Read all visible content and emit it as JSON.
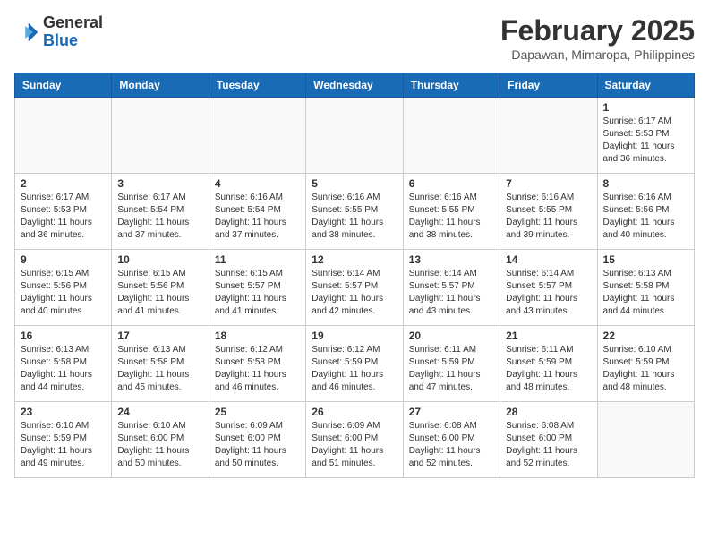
{
  "header": {
    "logo_general": "General",
    "logo_blue": "Blue",
    "month_year": "February 2025",
    "location": "Dapawan, Mimaropa, Philippines"
  },
  "weekdays": [
    "Sunday",
    "Monday",
    "Tuesday",
    "Wednesday",
    "Thursday",
    "Friday",
    "Saturday"
  ],
  "weeks": [
    [
      {
        "day": "",
        "info": ""
      },
      {
        "day": "",
        "info": ""
      },
      {
        "day": "",
        "info": ""
      },
      {
        "day": "",
        "info": ""
      },
      {
        "day": "",
        "info": ""
      },
      {
        "day": "",
        "info": ""
      },
      {
        "day": "1",
        "info": "Sunrise: 6:17 AM\nSunset: 5:53 PM\nDaylight: 11 hours\nand 36 minutes."
      }
    ],
    [
      {
        "day": "2",
        "info": "Sunrise: 6:17 AM\nSunset: 5:53 PM\nDaylight: 11 hours\nand 36 minutes."
      },
      {
        "day": "3",
        "info": "Sunrise: 6:17 AM\nSunset: 5:54 PM\nDaylight: 11 hours\nand 37 minutes."
      },
      {
        "day": "4",
        "info": "Sunrise: 6:16 AM\nSunset: 5:54 PM\nDaylight: 11 hours\nand 37 minutes."
      },
      {
        "day": "5",
        "info": "Sunrise: 6:16 AM\nSunset: 5:55 PM\nDaylight: 11 hours\nand 38 minutes."
      },
      {
        "day": "6",
        "info": "Sunrise: 6:16 AM\nSunset: 5:55 PM\nDaylight: 11 hours\nand 38 minutes."
      },
      {
        "day": "7",
        "info": "Sunrise: 6:16 AM\nSunset: 5:55 PM\nDaylight: 11 hours\nand 39 minutes."
      },
      {
        "day": "8",
        "info": "Sunrise: 6:16 AM\nSunset: 5:56 PM\nDaylight: 11 hours\nand 40 minutes."
      }
    ],
    [
      {
        "day": "9",
        "info": "Sunrise: 6:15 AM\nSunset: 5:56 PM\nDaylight: 11 hours\nand 40 minutes."
      },
      {
        "day": "10",
        "info": "Sunrise: 6:15 AM\nSunset: 5:56 PM\nDaylight: 11 hours\nand 41 minutes."
      },
      {
        "day": "11",
        "info": "Sunrise: 6:15 AM\nSunset: 5:57 PM\nDaylight: 11 hours\nand 41 minutes."
      },
      {
        "day": "12",
        "info": "Sunrise: 6:14 AM\nSunset: 5:57 PM\nDaylight: 11 hours\nand 42 minutes."
      },
      {
        "day": "13",
        "info": "Sunrise: 6:14 AM\nSunset: 5:57 PM\nDaylight: 11 hours\nand 43 minutes."
      },
      {
        "day": "14",
        "info": "Sunrise: 6:14 AM\nSunset: 5:57 PM\nDaylight: 11 hours\nand 43 minutes."
      },
      {
        "day": "15",
        "info": "Sunrise: 6:13 AM\nSunset: 5:58 PM\nDaylight: 11 hours\nand 44 minutes."
      }
    ],
    [
      {
        "day": "16",
        "info": "Sunrise: 6:13 AM\nSunset: 5:58 PM\nDaylight: 11 hours\nand 44 minutes."
      },
      {
        "day": "17",
        "info": "Sunrise: 6:13 AM\nSunset: 5:58 PM\nDaylight: 11 hours\nand 45 minutes."
      },
      {
        "day": "18",
        "info": "Sunrise: 6:12 AM\nSunset: 5:58 PM\nDaylight: 11 hours\nand 46 minutes."
      },
      {
        "day": "19",
        "info": "Sunrise: 6:12 AM\nSunset: 5:59 PM\nDaylight: 11 hours\nand 46 minutes."
      },
      {
        "day": "20",
        "info": "Sunrise: 6:11 AM\nSunset: 5:59 PM\nDaylight: 11 hours\nand 47 minutes."
      },
      {
        "day": "21",
        "info": "Sunrise: 6:11 AM\nSunset: 5:59 PM\nDaylight: 11 hours\nand 48 minutes."
      },
      {
        "day": "22",
        "info": "Sunrise: 6:10 AM\nSunset: 5:59 PM\nDaylight: 11 hours\nand 48 minutes."
      }
    ],
    [
      {
        "day": "23",
        "info": "Sunrise: 6:10 AM\nSunset: 5:59 PM\nDaylight: 11 hours\nand 49 minutes."
      },
      {
        "day": "24",
        "info": "Sunrise: 6:10 AM\nSunset: 6:00 PM\nDaylight: 11 hours\nand 50 minutes."
      },
      {
        "day": "25",
        "info": "Sunrise: 6:09 AM\nSunset: 6:00 PM\nDaylight: 11 hours\nand 50 minutes."
      },
      {
        "day": "26",
        "info": "Sunrise: 6:09 AM\nSunset: 6:00 PM\nDaylight: 11 hours\nand 51 minutes."
      },
      {
        "day": "27",
        "info": "Sunrise: 6:08 AM\nSunset: 6:00 PM\nDaylight: 11 hours\nand 52 minutes."
      },
      {
        "day": "28",
        "info": "Sunrise: 6:08 AM\nSunset: 6:00 PM\nDaylight: 11 hours\nand 52 minutes."
      },
      {
        "day": "",
        "info": ""
      }
    ]
  ]
}
